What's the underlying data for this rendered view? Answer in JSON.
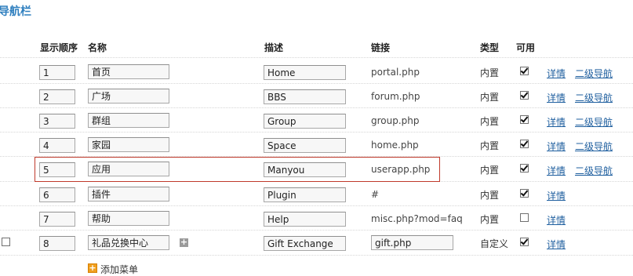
{
  "page": {
    "title": "导航栏"
  },
  "columns": {
    "order": "显示顺序",
    "name": "名称",
    "desc": "描述",
    "link": "链接",
    "type": "类型",
    "enabled": "可用"
  },
  "rows": [
    {
      "order": "1",
      "name": "首页",
      "desc": "Home",
      "link": "portal.php",
      "type": "内置",
      "enabled": true,
      "detail": "详情",
      "subnav": "二级导航"
    },
    {
      "order": "2",
      "name": "广场",
      "desc": "BBS",
      "link": "forum.php",
      "type": "内置",
      "enabled": true,
      "detail": "详情",
      "subnav": "二级导航"
    },
    {
      "order": "3",
      "name": "群组",
      "desc": "Group",
      "link": "group.php",
      "type": "内置",
      "enabled": true,
      "detail": "详情",
      "subnav": "二级导航"
    },
    {
      "order": "4",
      "name": "家园",
      "desc": "Space",
      "link": "home.php",
      "type": "内置",
      "enabled": true,
      "detail": "详情",
      "subnav": "二级导航"
    },
    {
      "order": "5",
      "name": "应用",
      "desc": "Manyou",
      "link": "userapp.php",
      "type": "内置",
      "enabled": true,
      "detail": "详情",
      "subnav": "二级导航"
    },
    {
      "order": "6",
      "name": "插件",
      "desc": "Plugin",
      "link": "#",
      "type": "内置",
      "enabled": true,
      "detail": "详情"
    },
    {
      "order": "7",
      "name": "帮助",
      "desc": "Help",
      "link": "misc.php?mod=faq",
      "type": "内置",
      "enabled": false,
      "detail": "详情"
    },
    {
      "order": "8",
      "name": "礼品兑换中心",
      "desc": "Gift Exchange",
      "link": "gift.php",
      "type": "自定义",
      "enabled": true,
      "detail": "详情"
    }
  ],
  "add_menu": {
    "label": "添加菜单",
    "icon": "plus-icon"
  },
  "colors": {
    "title": "#2f7fbf",
    "link": "#1f5f9f",
    "highlight": "#c0392b",
    "add_icon": "#f0a020"
  }
}
